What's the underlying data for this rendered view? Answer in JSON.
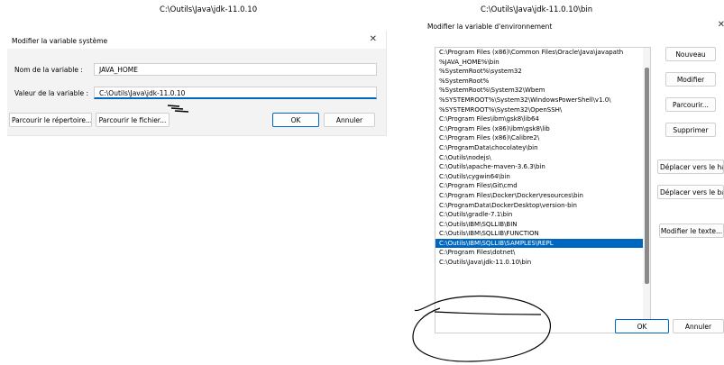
{
  "captions": {
    "left": "C:\\Outils\\Java\\jdk-11.0.10",
    "right": "C:\\Outils\\Java\\jdk-11.0.10\\bin"
  },
  "system_dialog": {
    "title": "Modifier la variable système",
    "close": "✕",
    "name_label": "Nom de la variable :",
    "name_value": "JAVA_HOME",
    "value_label": "Valeur de la variable :",
    "value_value": "C:\\Outils\\Java\\jdk-11.0.10",
    "browse_dir": "Parcourir le répertoire...",
    "browse_file": "Parcourir le fichier...",
    "ok": "OK",
    "cancel": "Annuler"
  },
  "env_dialog": {
    "title": "Modifier la variable d'environnement",
    "close": "✕",
    "selected_index": 20,
    "items": [
      "C:\\Program Files (x86)\\Common Files\\Oracle\\Java\\javapath",
      "%JAVA_HOME%\\bin",
      "%SystemRoot%\\system32",
      "%SystemRoot%",
      "%SystemRoot%\\System32\\Wbem",
      "%SYSTEMROOT%\\System32\\WindowsPowerShell\\v1.0\\",
      "%SYSTEMROOT%\\System32\\OpenSSH\\",
      "C:\\Program Files\\ibm\\gsk8\\lib64",
      "C:\\Program Files (x86)\\ibm\\gsk8\\lib",
      "C:\\Program Files (x86)\\Calibre2\\",
      "C:\\ProgramData\\chocolatey\\bin",
      "C:\\Outils\\nodejs\\",
      "C:\\Outils\\apache-maven-3.6.3\\bin",
      "C:\\Outils\\cygwin64\\bin",
      "C:\\Program Files\\Git\\cmd",
      "C:\\Program Files\\Docker\\Docker\\resources\\bin",
      "C:\\ProgramData\\DockerDesktop\\version-bin",
      "C:\\Outils\\gradle-7.1\\bin",
      "C:\\Outils\\IBM\\SQLLIB\\BIN",
      "C:\\Outils\\IBM\\SQLLIB\\FUNCTION",
      "C:\\Outils\\IBM\\SQLLIB\\SAMPLES\\REPL",
      "C:\\Program Files\\dotnet\\",
      "C:\\Outils\\Java\\jdk-11.0.10\\bin"
    ],
    "buttons": {
      "new": "Nouveau",
      "edit": "Modifier",
      "browse": "Parcourir...",
      "delete": "Supprimer",
      "move_up": "Déplacer vers le haut",
      "move_down": "Déplacer vers le bas",
      "edit_text": "Modifier le texte...",
      "ok": "OK",
      "cancel": "Annuler"
    }
  }
}
